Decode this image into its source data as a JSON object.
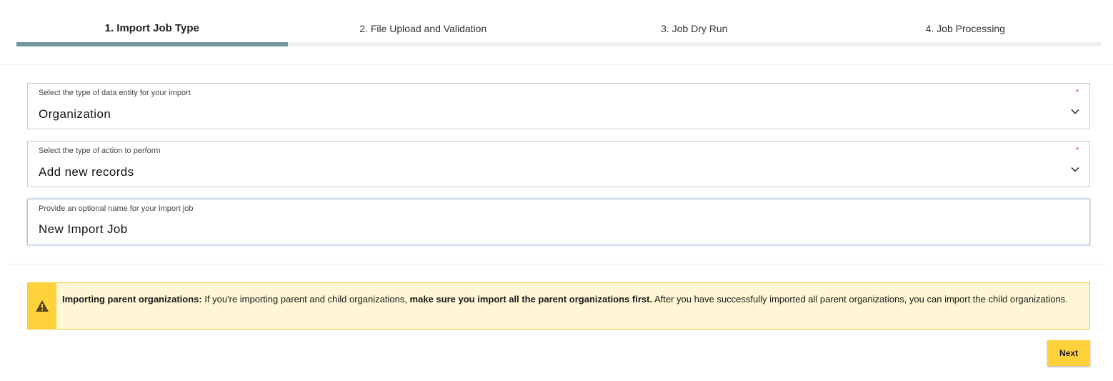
{
  "stepper": {
    "steps": [
      {
        "label": "1. Import Job Type",
        "active": true
      },
      {
        "label": "2. File Upload and Validation",
        "active": false
      },
      {
        "label": "3. Job Dry Run",
        "active": false
      },
      {
        "label": "4. Job Processing",
        "active": false
      }
    ],
    "progress_fraction": 0.25,
    "progress_color": "#6f969a"
  },
  "fields": {
    "entity": {
      "label": "Select the type of data entity for your import",
      "value": "Organization",
      "required_marker": "*",
      "icon": "chevron-down-icon"
    },
    "action": {
      "label": "Select the type of action to perform",
      "value": "Add new records",
      "required_marker": "*",
      "icon": "chevron-down-icon"
    },
    "job_name": {
      "label": "Provide an optional name for your import job",
      "value": "New Import Job"
    }
  },
  "banner": {
    "icon": "warning-icon",
    "bold_lead": "Importing parent organizations:",
    "text_1": " If you're importing parent and child organizations, ",
    "bold_mid": "make sure you import all the parent organizations first.",
    "text_2": " After you have successfully imported all parent organizations, you can import the child organizations.",
    "accent_color": "#ffd23c",
    "background_color": "#fef6d4"
  },
  "footer": {
    "next_label": "Next"
  }
}
